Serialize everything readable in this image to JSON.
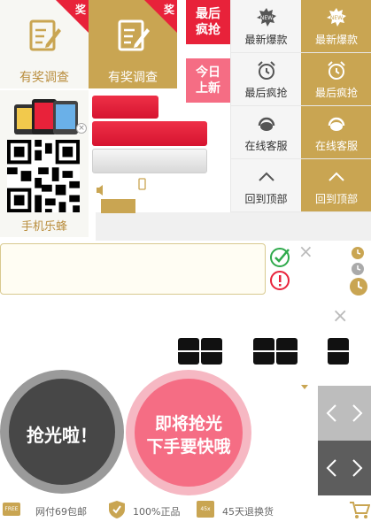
{
  "survey": {
    "tile1": {
      "label": "有奖调查",
      "ribbon": "奖"
    },
    "tile2": {
      "label": "有奖调查",
      "ribbon": "奖"
    }
  },
  "tags": {
    "rush": "最后\n疯抢",
    "today": "今日\n上新"
  },
  "side_grid": {
    "new_light": "最新爆款",
    "new_gold": "最新爆款",
    "rush_light": "最后疯抢",
    "rush_gold": "最后疯抢",
    "service_light": "在线客服",
    "service_gold": "在线客服",
    "top_light": "回到顶部",
    "top_gold": "回到顶部",
    "new_badge": "NEW"
  },
  "qr": {
    "label": "手机乐蜂"
  },
  "circles": {
    "sold_out": "抢光啦！",
    "coming_line1": "即将抢光",
    "coming_line2": "下手要快哦"
  },
  "bottom_bar": {
    "shipping": "网付69包邮",
    "genuine": "100%正品",
    "returns": "45天退换货",
    "free_badge": "FREE",
    "days_badge": "45x"
  },
  "colors": {
    "gold": "#c9a552",
    "pink": "#f56d84",
    "red": "#e8223a",
    "dark": "#444444",
    "bar_bg": "#f4f4f4"
  }
}
